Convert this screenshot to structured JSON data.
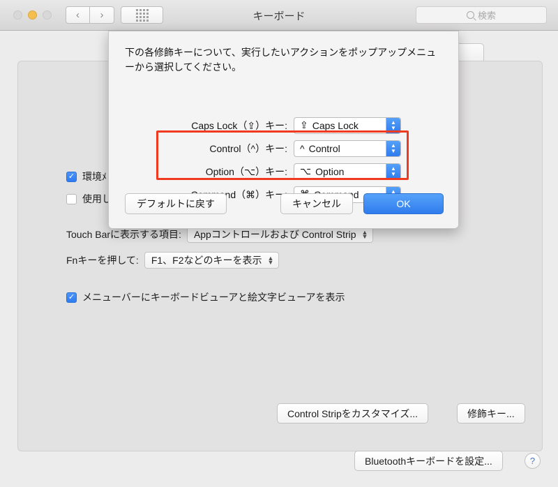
{
  "window": {
    "title": "キーボード",
    "traffic_lights": [
      "close-button",
      "minimize-button",
      "zoom-button"
    ],
    "nav": {
      "back": "‹",
      "forward": "›"
    },
    "grid_button": "show-all-button"
  },
  "search": {
    "placeholder": "検索",
    "value": ""
  },
  "background_panel": {
    "checkboxes": [
      {
        "label": "環境ﾒ",
        "checked": true
      },
      {
        "label": "使用し",
        "checked": false
      },
      {
        "label": "メニューバーにキーボードビューアと絵文字ビューアを表示",
        "checked": true
      }
    ],
    "fields": [
      {
        "label": "Touch Barに表示する項目:",
        "value": "Appコントロールおよび Control Strip"
      },
      {
        "label": "Fnキーを押して:",
        "value": "F1、F2などのキーを表示"
      }
    ],
    "buttons": [
      "Control Stripをカスタマイズ...",
      "修飾キー...",
      "Bluetoothキーボードを設定..."
    ],
    "help_button": "?"
  },
  "sheet": {
    "description": "下の各修飾キーについて、実行したいアクションをポップアップメニューから選択してください。",
    "rows": [
      {
        "label": "Caps Lock（⇪）キー:",
        "symbol": "⇪",
        "value": "Caps Lock"
      },
      {
        "label": "Control（^）キー:",
        "symbol": "^",
        "value": "Control"
      },
      {
        "label": "Option（⌥）キー:",
        "symbol": "⌥",
        "value": "Option"
      },
      {
        "label": "Command（⌘）キー:",
        "symbol": "⌘",
        "value": "Command"
      }
    ],
    "buttons": {
      "restore_defaults": "デフォルトに戻す",
      "cancel": "キャンセル",
      "ok": "OK"
    },
    "stepper_up": "▲",
    "stepper_down": "▼"
  },
  "annotation": {
    "color": "#f03a20",
    "highlights": [
      "Option row",
      "Command row"
    ]
  }
}
